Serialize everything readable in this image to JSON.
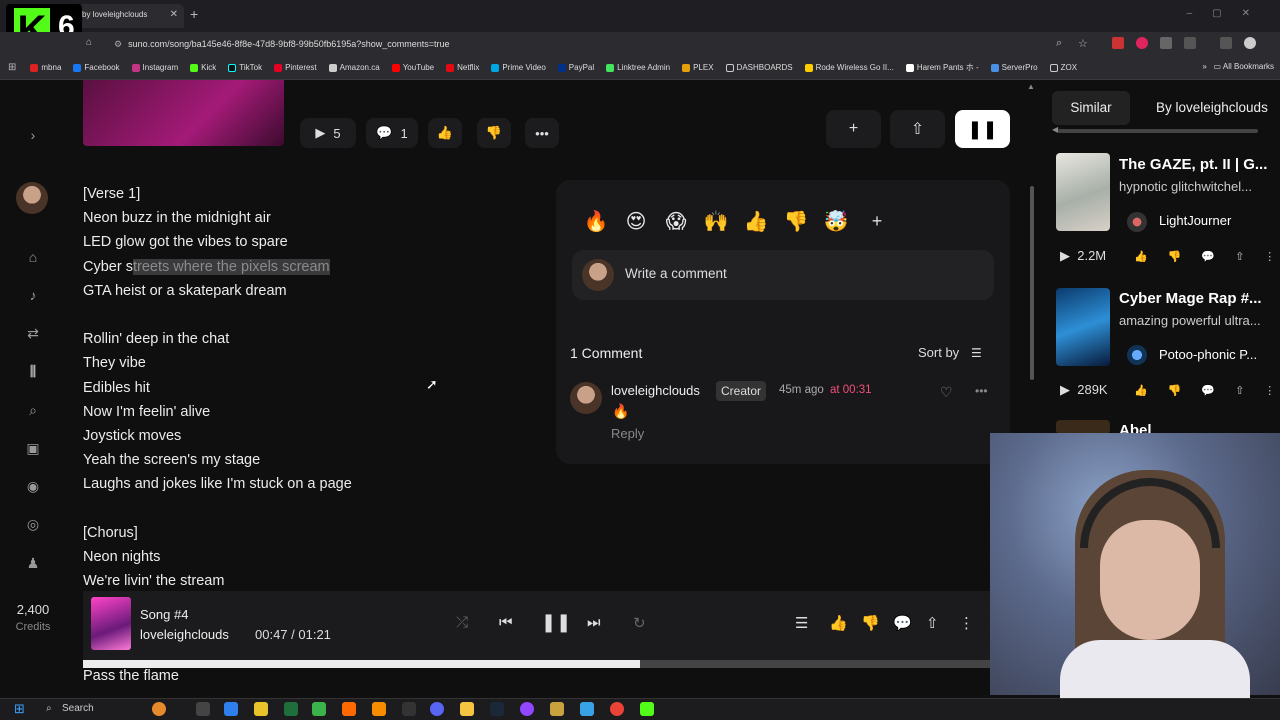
{
  "browser": {
    "tab_title": "by loveleighclouds",
    "url": "suno.com/song/ba145e46-8f8e-47d8-9bf8-99b50fb6195a?show_comments=true",
    "bookmarks": [
      "mbna",
      "Facebook",
      "Instagram",
      "Kick",
      "TikTok",
      "Pinterest",
      "Amazon.ca",
      "YouTube",
      "Netflix",
      "Prime Video",
      "PayPal",
      "Linktree Admin",
      "PLEX",
      "DASHBOARDS",
      "Rode Wireless Go II...",
      "Harem Pants ホ -",
      "ServerPro",
      "ZOX"
    ],
    "all_bookmarks": "All Bookmarks"
  },
  "overlay": {
    "stream_badge_number": "6"
  },
  "song_actions": {
    "play_count": "5",
    "comment_count": "1"
  },
  "lyrics": [
    "[Verse 1]",
    "Neon buzz in the midnight air",
    "LED glow got the vibes to spare",
    "Cyber s",
    "GTA heist or a skatepark dream",
    "",
    "Rollin' deep in the chat",
    "They vibe",
    "Edibles hit",
    "Now I'm feelin' alive",
    "Joystick moves",
    "Yeah the screen's my stage",
    "Laughs and jokes like I'm stuck on a page",
    "",
    "[Chorus]",
    "Neon nights",
    "We're livin' the stream"
  ],
  "lyrics_highlight": "treets where the pixels scream",
  "lyrics_after_player": "Pass the flame",
  "comments": {
    "reactions": [
      "🔥",
      "😍",
      "😱",
      "🙌",
      "👍",
      "👎",
      "🤯"
    ],
    "placeholder": "Write a comment",
    "count_label": "1 Comment",
    "sort_label": "Sort by",
    "items": [
      {
        "user": "loveleighclouds",
        "badge": "Creator",
        "time": "45m ago",
        "at": "at 00:31",
        "text": "🔥",
        "reply": "Reply"
      }
    ]
  },
  "sidebar": {
    "credits": "2,400",
    "credits_label": "Credits"
  },
  "right_panel": {
    "tabs": [
      "Similar",
      "By loveleighclouds"
    ],
    "songs": [
      {
        "title": "The GAZE, pt. II | G...",
        "desc": "hypnotic glitchwitchel...",
        "author": "LightJourner",
        "plays": "2.2M"
      },
      {
        "title": "Cyber Mage Rap #...",
        "desc": "amazing powerful ultra...",
        "author": "Potoo-phonic P...",
        "plays": "289K"
      },
      {
        "title": "Abel"
      }
    ]
  },
  "player": {
    "title": "Song #4",
    "artist": "loveleighclouds",
    "time": "00:47 / 01:21",
    "progress": 0.614
  },
  "taskbar": {
    "search_label": "Search"
  },
  "colors": {
    "accent_pink": "#f0507a",
    "kick_green": "#53fc18"
  }
}
